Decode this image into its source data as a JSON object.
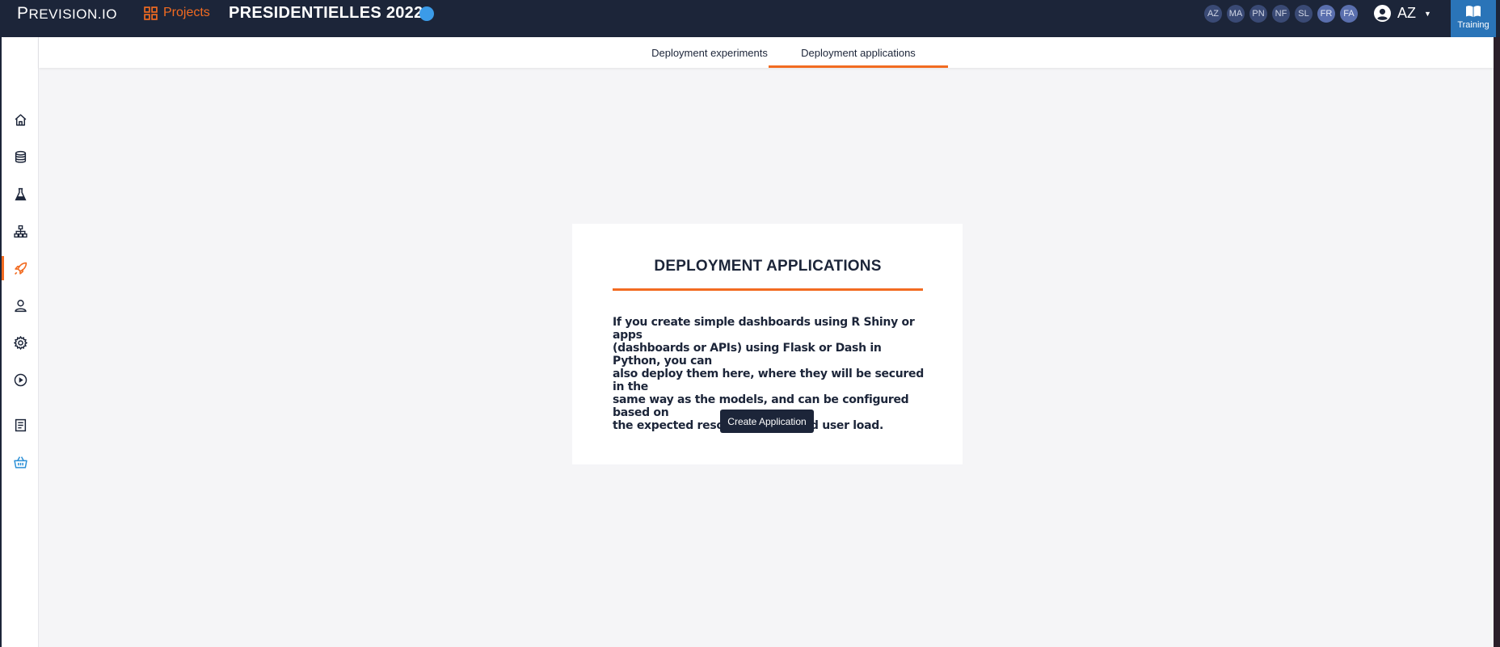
{
  "app": {
    "logo_first": "P",
    "logo_rest": "REVISION.IO",
    "projects_label": "Projects",
    "project_title": "PRESIDENTIELLES 2022",
    "status_color": "#3b9be8",
    "brand_accent": "#f26b21",
    "header_bg": "#1c2539"
  },
  "collaborators": [
    "AZ",
    "MA",
    "PN",
    "NF",
    "SL",
    "FR",
    "FA"
  ],
  "user": {
    "initials": "AZ"
  },
  "training": {
    "label": "Training",
    "icon": "book-icon"
  },
  "sidebar": {
    "items": [
      {
        "name": "home",
        "icon": "home-icon"
      },
      {
        "name": "data",
        "icon": "database-icon"
      },
      {
        "name": "experiments",
        "icon": "flask-icon"
      },
      {
        "name": "pipelines",
        "icon": "pipeline-icon"
      },
      {
        "name": "deployments",
        "icon": "rocket-icon",
        "active": true
      },
      {
        "name": "users",
        "icon": "user-icon"
      },
      {
        "name": "settings",
        "icon": "gear-icon"
      },
      {
        "name": "scheduler",
        "icon": "play-circle-icon"
      },
      {
        "name": "documentation",
        "icon": "book-page-icon"
      },
      {
        "name": "store",
        "icon": "basket-icon"
      }
    ]
  },
  "tabs": [
    {
      "label": "Deployment experiments",
      "active": false
    },
    {
      "label": "Deployment applications",
      "active": true
    }
  ],
  "card": {
    "title": "DEPLOYMENT APPLICATIONS",
    "description_lines": [
      "If you create simple dashboards using R Shiny or apps",
      "(dashboards or APIs) using Flask or Dash in Python, you can",
      "also deploy them here, where they will be secured in the",
      "same way as the models, and can be configured based on",
      "the expected resource usage and user load."
    ],
    "button_label": "Create Application"
  }
}
